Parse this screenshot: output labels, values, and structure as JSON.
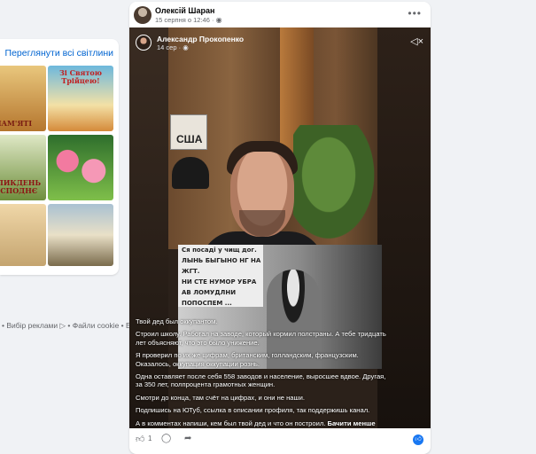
{
  "sidebar": {
    "see_all_link": "Переглянути всі світлини",
    "thumbnails": [
      {
        "caption": "ПАМ'ЯТІ",
        "subject": "saints-icon"
      },
      {
        "caption": "Зі Святою Трійцею!",
        "subject": "trinity-icon"
      },
      {
        "caption": "ВЕЛИКДЕНЬ ГОСПОДНЄ",
        "subject": "angels-icon"
      },
      {
        "caption": "",
        "subject": "flowers-icon"
      },
      {
        "caption": "",
        "subject": "church-icon"
      },
      {
        "caption": "",
        "subject": "resurrection-icon"
      }
    ],
    "footer": "• Вибір реклами ▷ • Файли cookie • Більше"
  },
  "post": {
    "author": "Олексій Шаран",
    "date": "15 серпня о 12:46 · ",
    "more_icon": "more-horizontal-icon",
    "video": {
      "author": "Александр Прокопенко",
      "meta": "14 сер · ",
      "sign_text": "США",
      "board_lines": [
        "Ся посаді у чищ дог.",
        "ЛЫНЬ БЫГЫНО НГ НА ЖГТ.",
        "НИ СТЕ НУМОР УБРА",
        "АВ ЛОМУДЛНИ ПОПОСПЕМ ..."
      ],
      "caption": [
        "Твой дед был оккупантом.",
        "Строил школу. Работал на заводе, который кормил полстраны. А тебе тридцать лет объясняют, что это было унижение.",
        "Я проверил по их же цифрам, британским, голландским, французским. Оказалось, оккупация оккупации рознь.",
        "Одна оставляет после себя 558 заводов и население, выросшее вдвое. Другая, за 350 лет, полпроцента грамотных женщин.",
        "Смотри до конца, там счёт на цифрах, и они не наши.",
        "Подпишись на ЮТуб, ссылка в описании профиля, так поддержишь канал.",
        "А в комментах напиши, кем был твой дед и что он построил."
      ],
      "show_more": "Бачити менше"
    },
    "reactions": {
      "like_count": "1"
    }
  }
}
